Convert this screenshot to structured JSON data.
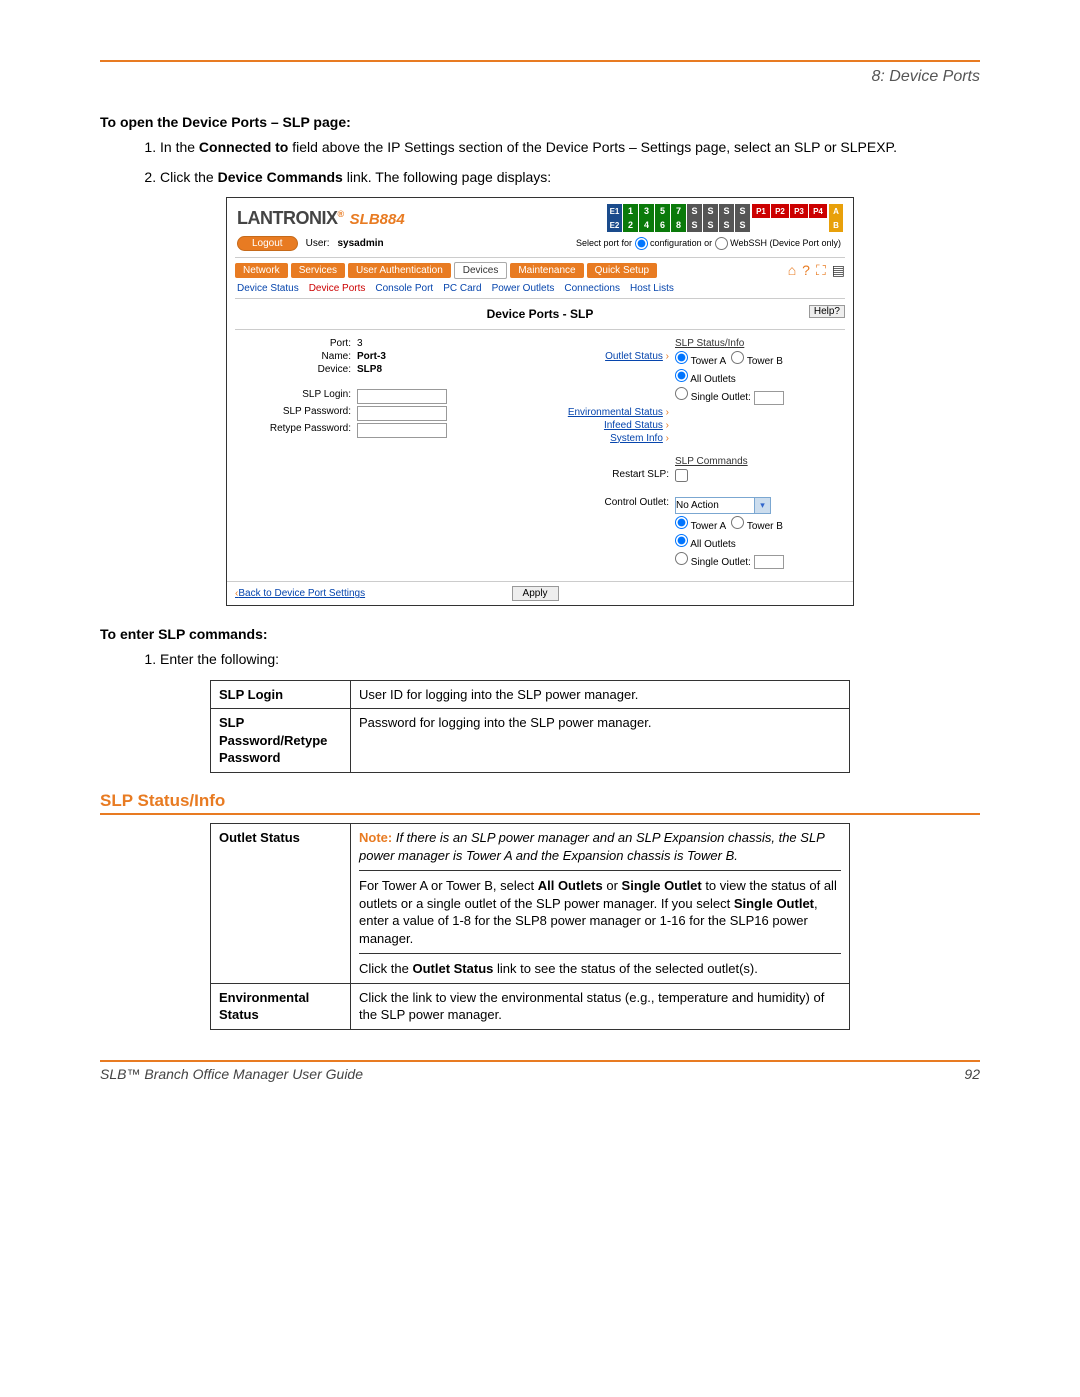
{
  "chapter": "8: Device Ports",
  "heading1": "To open the Device Ports – SLP page:",
  "steps1": [
    {
      "pre": "In the ",
      "b1": "Connected to",
      "post": " field above the IP Settings section of the Device Ports – Settings page, select an SLP or SLPEXP."
    },
    {
      "pre": "Click the ",
      "b1": "Device Commands",
      "post": " link. The following page displays:"
    }
  ],
  "shot": {
    "logo": "LANTRONI",
    "logo_x": "X",
    "model": "SLB884",
    "ports_e": [
      "E1",
      "E2"
    ],
    "ports_green": [
      "1",
      "3",
      "5",
      "7",
      "2",
      "4",
      "6",
      "8"
    ],
    "ports_s": [
      "S",
      "S",
      "S",
      "S",
      "S",
      "S",
      "S",
      "S"
    ],
    "ports_p": [
      "P1",
      "P2",
      "P3",
      "P4"
    ],
    "ports_ab": [
      "A",
      "B"
    ],
    "user_label": "User:",
    "user": "sysadmin",
    "logout": "Logout",
    "portsel_label": "Select port for",
    "portsel_a": "configuration or",
    "portsel_b": "WebSSH (Device Port only)",
    "tabs": [
      "Network",
      "Services",
      "User Authentication",
      "Devices",
      "Maintenance",
      "Quick Setup"
    ],
    "subtabs": [
      "Device Status",
      "Device Ports",
      "Console Port",
      "PC Card",
      "Power Outlets",
      "Connections",
      "Host Lists"
    ],
    "panel_title": "Device Ports - SLP",
    "help": "Help?",
    "left": {
      "port_lab": "Port:",
      "port": "3",
      "name_lab": "Name:",
      "name": "Port-3",
      "device_lab": "Device:",
      "device": "SLP8",
      "login_lab": "SLP Login:",
      "pw_lab": "SLP Password:",
      "retype_lab": "Retype Password:"
    },
    "right": {
      "status_hdr": "SLP Status/Info",
      "outlet_link": "Outlet Status",
      "tower_a": "Tower A",
      "tower_b": "Tower B",
      "all_outlets": "All Outlets",
      "single_outlet": "Single Outlet:",
      "env_link": "Environmental Status",
      "infeed_link": "Infeed Status",
      "sys_link": "System Info",
      "cmds_hdr": "SLP Commands",
      "restart": "Restart SLP:",
      "control": "Control Outlet:",
      "control_val": "No Action"
    },
    "back": "Back to Device Port Settings",
    "apply": "Apply"
  },
  "heading2": "To enter SLP commands:",
  "enter_text": "Enter the following:",
  "table1": [
    {
      "label": "SLP Login",
      "desc": "User ID for logging into the SLP power manager."
    },
    {
      "label": "SLP Password/Retype Password",
      "desc": "Password for logging into the SLP power manager."
    }
  ],
  "section_heading": "SLP Status/Info",
  "table2": {
    "row1_label": "Outlet Status",
    "row1_note_lead": "Note:",
    "row1_note_it": " If there is an SLP power manager and an SLP Expansion chassis, the SLP power manager is Tower A and the Expansion chassis is Tower B.",
    "row1_p2a": "For Tower A or Tower B, select ",
    "row1_p2b": "All Outlets",
    "row1_p2c": " or ",
    "row1_p2d": "Single Outlet",
    "row1_p2e": " to view the status of all outlets or a single outlet of the SLP power manager. If you select ",
    "row1_p2f": "Single Outlet",
    "row1_p2g": ", enter a value of 1-8 for the SLP8 power manager or 1-16 for the SLP16 power manager.",
    "row1_p3a": "Click the ",
    "row1_p3b": "Outlet Status",
    "row1_p3c": " link to see the status of the selected outlet(s).",
    "row2_label": "Environmental Status",
    "row2_desc": "Click the link to view the environmental status (e.g., temperature and humidity) of the SLP power manager."
  },
  "footer": {
    "title": "SLB™ Branch Office Manager User Guide",
    "page": "92"
  }
}
